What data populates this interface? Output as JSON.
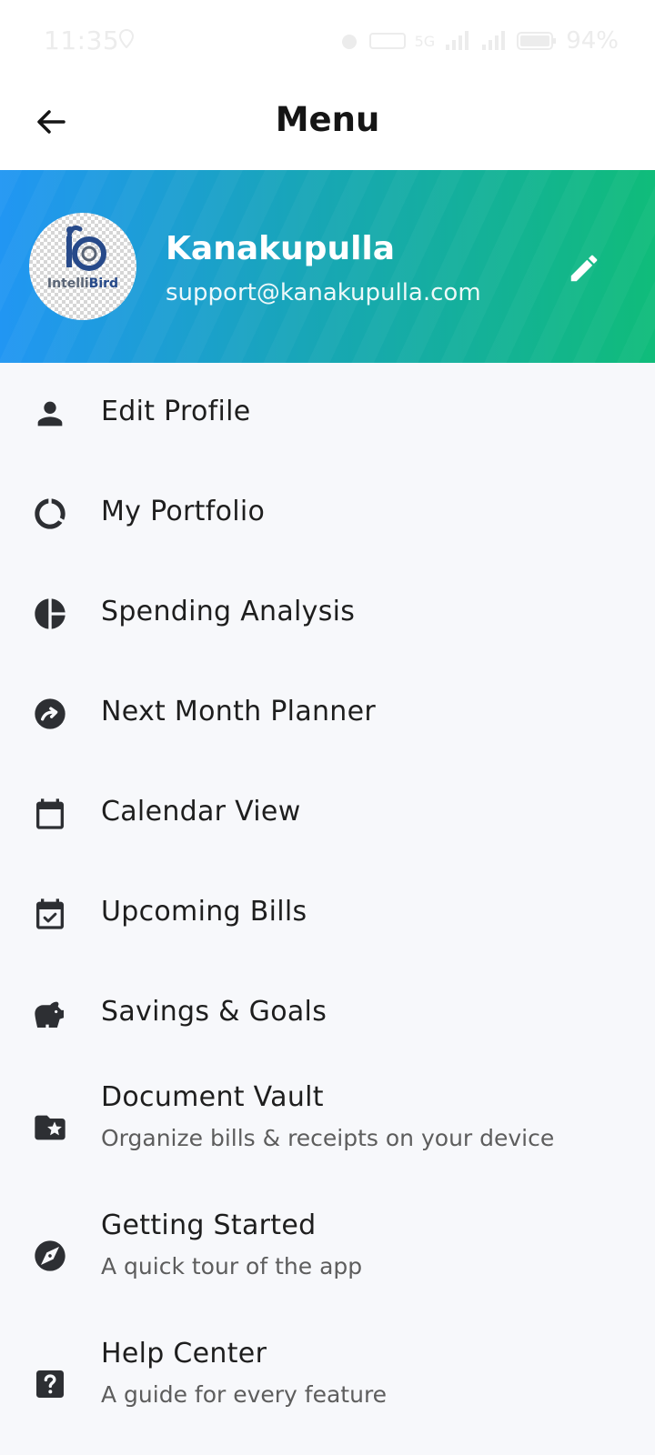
{
  "status_bar": {
    "time": "11:35",
    "battery": "94%",
    "network": "5G"
  },
  "header": {
    "title": "Menu",
    "back_icon": "arrow-left-icon"
  },
  "profile": {
    "name": "Kanakupulla",
    "email": "support@kanakupulla.com",
    "avatar_text_a": "Intelli",
    "avatar_text_b": "Bird",
    "edit_icon": "pencil-icon",
    "gradient_start": "#2196f3",
    "gradient_end": "#10bc7a"
  },
  "menu": {
    "items": [
      {
        "label": "Edit Profile",
        "icon": "person-icon"
      },
      {
        "label": "My Portfolio",
        "icon": "donut-chart-icon"
      },
      {
        "label": "Spending Analysis",
        "icon": "pie-chart-icon"
      },
      {
        "label": "Next Month Planner",
        "icon": "trend-arrow-icon"
      },
      {
        "label": "Calendar View",
        "icon": "calendar-icon"
      },
      {
        "label": "Upcoming Bills",
        "icon": "calendar-check-icon"
      },
      {
        "label": "Savings & Goals",
        "icon": "piggy-bank-icon"
      },
      {
        "label": "Document Vault",
        "sublabel": "Organize bills & receipts on your device",
        "icon": "folder-star-icon"
      },
      {
        "label": "Getting Started",
        "sublabel": "A quick tour of the app",
        "icon": "compass-icon"
      },
      {
        "label": "Help Center",
        "sublabel": "A guide for every feature",
        "icon": "help-icon"
      }
    ]
  }
}
